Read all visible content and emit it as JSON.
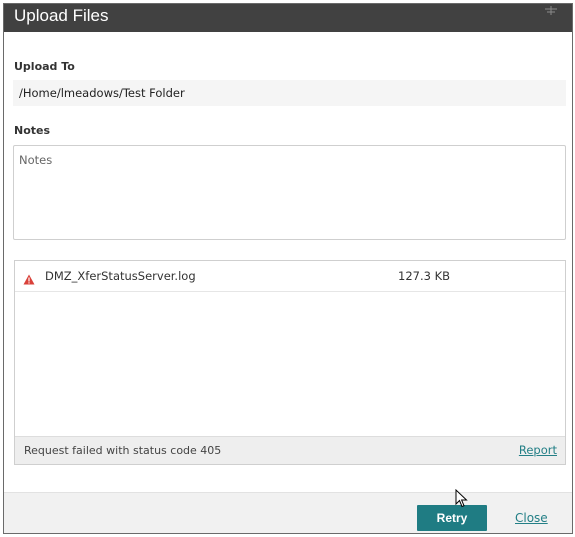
{
  "dialog": {
    "title": "Upload Files",
    "title_icon": "pin-icon"
  },
  "upload_to": {
    "label": "Upload To",
    "path": "/Home/lmeadows/Test Folder"
  },
  "notes": {
    "label": "Notes",
    "placeholder": "Notes",
    "value": ""
  },
  "files": [
    {
      "name": "DMZ_XferStatusServer.log",
      "size": "127.3 KB",
      "status_icon": "warning-triangle-icon"
    }
  ],
  "status": {
    "message": "Request failed with status code 405",
    "report_label": "Report"
  },
  "footer": {
    "retry_label": "Retry",
    "close_label": "Close"
  },
  "colors": {
    "title_bar": "#414141",
    "accent": "#1f7c83",
    "warning": "#d9413a"
  }
}
